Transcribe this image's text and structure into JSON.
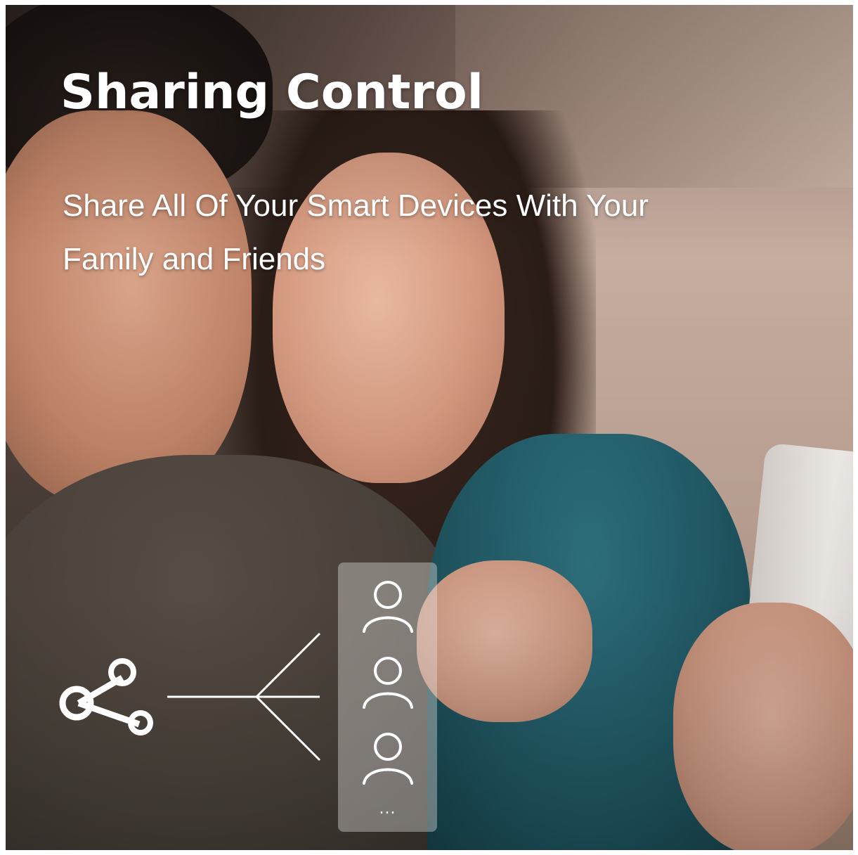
{
  "hero": {
    "title": "Sharing Control",
    "subtitle": "Share All Of Your Smart Devices With Your Family and Friends"
  },
  "graphic": {
    "share_icon": "share-icon",
    "user_icon": "user-outline-icon",
    "more_indicator": "..."
  }
}
